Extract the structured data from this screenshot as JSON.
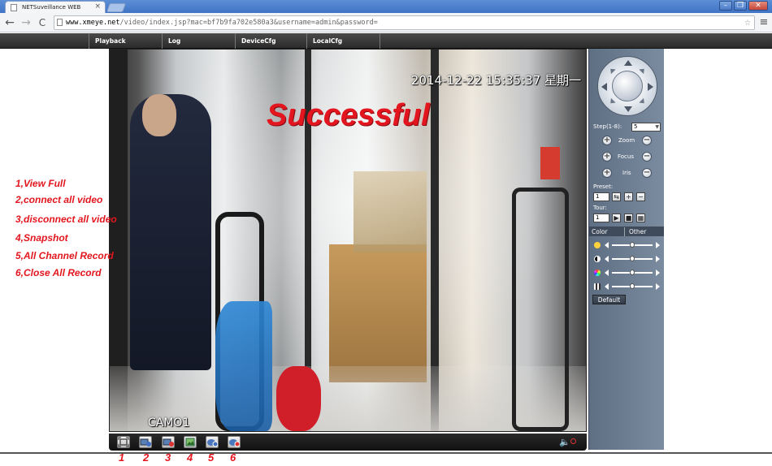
{
  "browser": {
    "tab_title": "NETSuveillance WEB",
    "tab_close": "×",
    "url_host": "www.xmeye.net",
    "url_rest": "/video/index.jsp?mac=bf7b9fa702e580a3&username=admin&password=",
    "back": "←",
    "forward": "→",
    "reload": "C",
    "star": "☆",
    "menu": "≡",
    "win_minimize": "–",
    "win_restore": "❐",
    "win_close": "✕"
  },
  "menu": {
    "items": [
      "Playback",
      "Log",
      "DeviceCfg",
      "LocalCfg"
    ]
  },
  "video": {
    "timestamp": "2014-12-22 15:35:37 星期一",
    "camera_name": "CAMO1",
    "overlay": "Successful"
  },
  "annotations": [
    "1,View Full",
    "2,connect all video",
    "3,disconnect all video",
    "4,Snapshot",
    "5,All Channel Record",
    "6,Close All Record"
  ],
  "toolbar_numbers": [
    "1",
    "2",
    "3",
    "4",
    "5",
    "6"
  ],
  "toolbar_icons": [
    "fullscreen-icon",
    "connect-all-icon",
    "disconnect-all-icon",
    "snapshot-icon",
    "record-all-icon",
    "stop-record-icon"
  ],
  "panel": {
    "step_label": "Step(1-8):",
    "step_value": "5",
    "zoom_label": "Zoom",
    "focus_label": "Focus",
    "iris_label": "Iris",
    "plus": "+",
    "minus": "−",
    "preset_label": "Preset:",
    "preset_value": "1",
    "tour_label": "Tour:",
    "tour_value": "1",
    "tab_color": "Color",
    "tab_other": "Other",
    "default_button": "Default",
    "sliders": [
      {
        "name": "brightness",
        "level": 0.5
      },
      {
        "name": "contrast",
        "level": 0.5
      },
      {
        "name": "saturation",
        "level": 0.5
      },
      {
        "name": "hue",
        "level": 0.5
      }
    ]
  },
  "colors": {
    "annotation_red": "#e3161f",
    "panel_bg": "#6c7c91",
    "menubar_bg": "#333333"
  }
}
